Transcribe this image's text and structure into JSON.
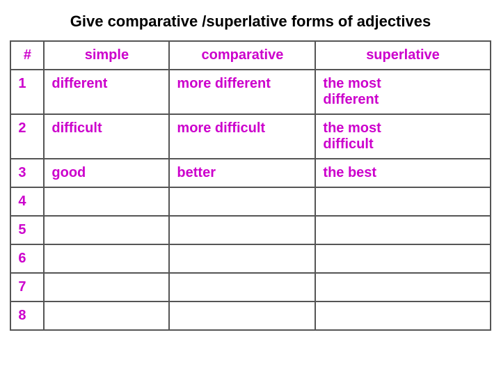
{
  "title": "Give comparative /superlative forms of adjectives",
  "table": {
    "headers": {
      "num": "#",
      "simple": "simple",
      "comparative": "comparative",
      "superlative": "superlative"
    },
    "rows": [
      {
        "num": "1",
        "simple": "different",
        "comparative": "more different",
        "superlative": "the most\ndifferent"
      },
      {
        "num": "2",
        "simple": "difficult",
        "comparative": "more difficult",
        "superlative": "the most\ndifficult"
      },
      {
        "num": "3",
        "simple": "good",
        "comparative": "better",
        "superlative": "the best"
      },
      {
        "num": "4",
        "simple": "",
        "comparative": "",
        "superlative": ""
      },
      {
        "num": "5",
        "simple": "",
        "comparative": "",
        "superlative": ""
      },
      {
        "num": "6",
        "simple": "",
        "comparative": "",
        "superlative": ""
      },
      {
        "num": "7",
        "simple": "",
        "comparative": "",
        "superlative": ""
      },
      {
        "num": "8",
        "simple": "",
        "comparative": "",
        "superlative": ""
      }
    ]
  }
}
